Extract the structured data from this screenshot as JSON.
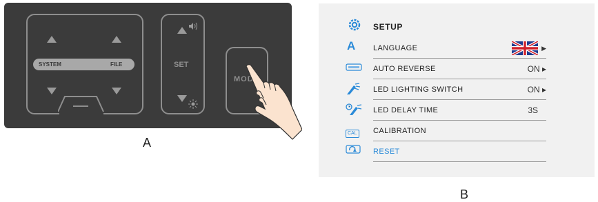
{
  "panel_a": {
    "caption": "A",
    "system_label": "SYSTEM",
    "file_label": "FILE",
    "set_label": "SET",
    "mode_label": "MODE"
  },
  "panel_b": {
    "caption": "B",
    "title": "SETUP",
    "accent_color": "#2a8ad8",
    "rows": [
      {
        "label": "LANGUAGE",
        "value": "",
        "icon": "letter-a-icon"
      },
      {
        "label": "AUTO REVERSE",
        "value": "ON ▸",
        "icon": "auto-reverse-icon"
      },
      {
        "label": "LED LIGHTING SWITCH",
        "value": "ON ▸",
        "icon": "led-light-icon"
      },
      {
        "label": "LED DELAY TIME",
        "value": "3S",
        "icon": "led-delay-icon"
      },
      {
        "label": "CALIBRATION",
        "value": "",
        "icon": "cal-icon"
      },
      {
        "label": "RESET",
        "value": "",
        "icon": "reset-icon"
      }
    ],
    "cal_icon_text": "CAL",
    "letter_icon_text": "A"
  }
}
